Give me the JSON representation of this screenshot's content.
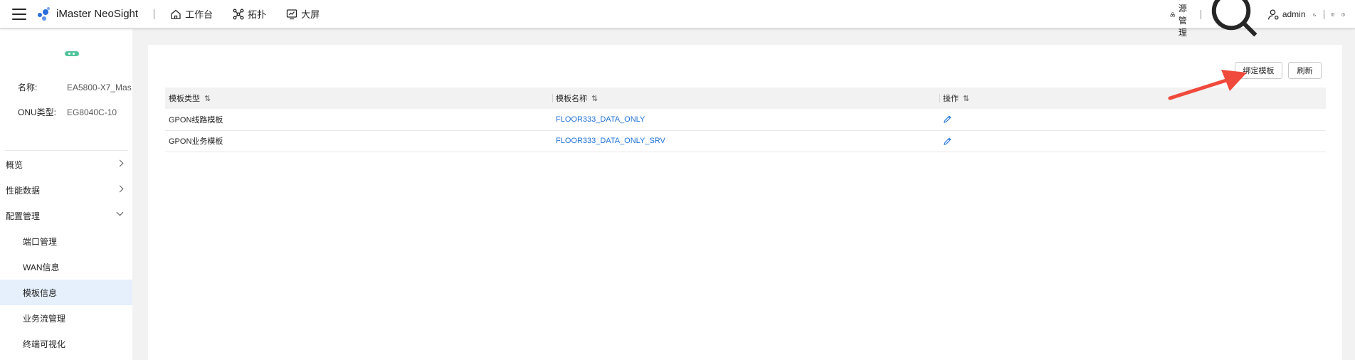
{
  "header": {
    "app_name": "iMaster NeoSight",
    "nav": [
      {
        "label": "工作台",
        "icon": "home-icon"
      },
      {
        "label": "拓扑",
        "icon": "topology-icon"
      },
      {
        "label": "大屏",
        "icon": "screen-icon"
      }
    ],
    "resource_mgmt_label": "资源管理",
    "user_label": "admin"
  },
  "device": {
    "name_key": "名称:",
    "name_value": "EA5800-X7_Mas",
    "onu_type_key": "ONU类型:",
    "onu_type_value": "EG8040C-10"
  },
  "sidebar": {
    "items": [
      {
        "label": "概览"
      },
      {
        "label": "性能数据"
      },
      {
        "label": "配置管理"
      }
    ],
    "subitems": [
      {
        "label": "端口管理"
      },
      {
        "label": "WAN信息"
      },
      {
        "label": "模板信息"
      },
      {
        "label": "业务流管理"
      },
      {
        "label": "终端可视化"
      }
    ]
  },
  "toolbar": {
    "bind_label": "绑定模板",
    "refresh_label": "刷新"
  },
  "table": {
    "columns": [
      "模板类型",
      "模板名称",
      "操作"
    ],
    "sort_glyph": "⇅",
    "rows": [
      {
        "type": "GPON线路模板",
        "name": "FLOOR333_DATA_ONLY"
      },
      {
        "type": "GPON业务模板",
        "name": "FLOOR333_DATA_ONLY_SRV"
      }
    ]
  },
  "colors": {
    "accent": "#1f73d8",
    "active_menu_bg": "#e6f0fd",
    "status_green": "#52c49a",
    "annotation_arrow": "#ef4a3c"
  }
}
